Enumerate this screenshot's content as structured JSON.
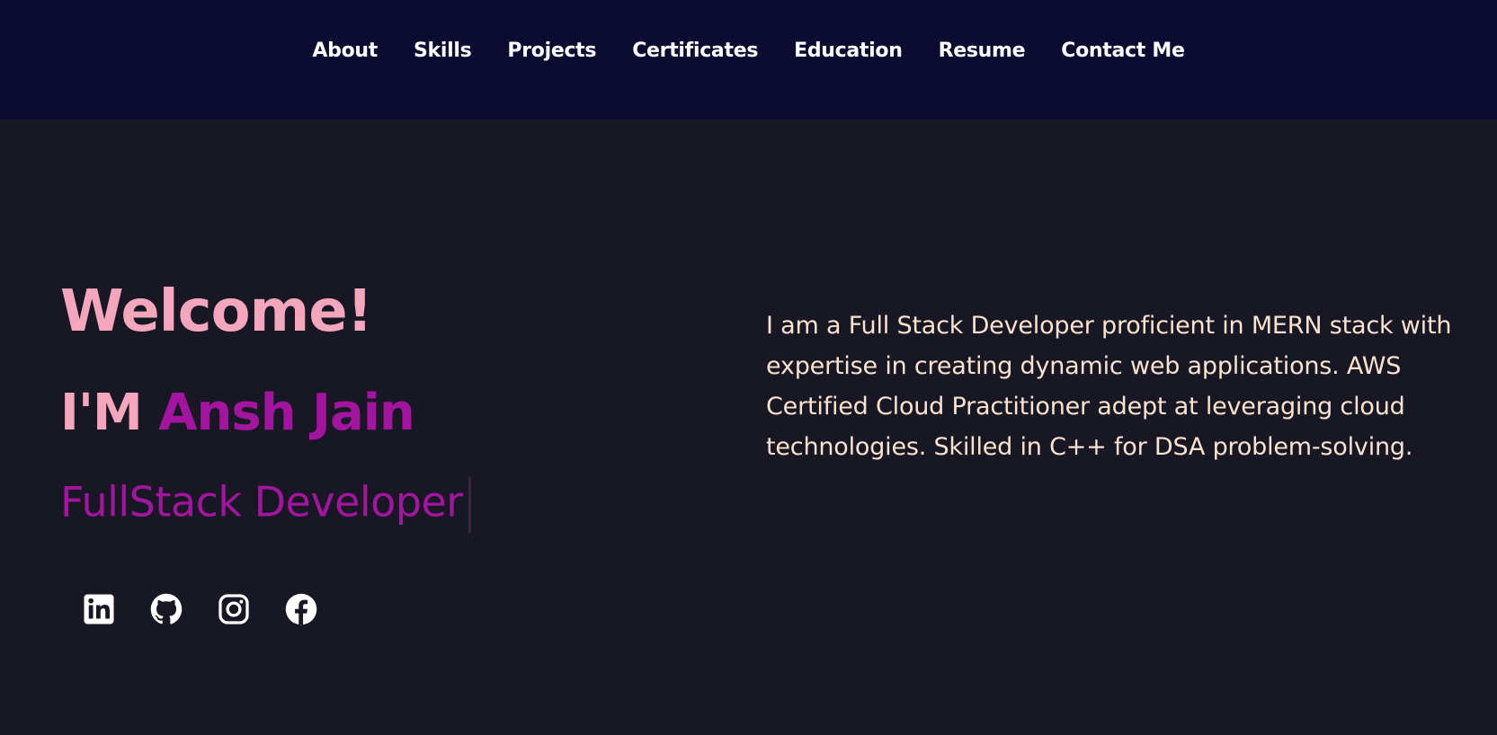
{
  "nav": {
    "items": [
      {
        "label": "About"
      },
      {
        "label": "Skills"
      },
      {
        "label": "Projects"
      },
      {
        "label": "Certificates"
      },
      {
        "label": "Education"
      },
      {
        "label": "Resume"
      },
      {
        "label": "Contact Me"
      }
    ]
  },
  "hero": {
    "welcome": "Welcome!",
    "intro_prefix": "I'M ",
    "name": "Ansh Jain",
    "role": "FullStack Developer",
    "bio": "I am a Full Stack Developer proficient in MERN stack with expertise in creating dynamic web applications. AWS Certified Cloud Practitioner adept at leveraging cloud technologies. Skilled in C++ for DSA problem-solving."
  },
  "socials": [
    {
      "icon": "linkedin-icon"
    },
    {
      "icon": "github-icon"
    },
    {
      "icon": "instagram-icon"
    },
    {
      "icon": "facebook-icon"
    }
  ],
  "colors": {
    "nav_bg": "#0c0c33",
    "page_bg": "#181824",
    "accent_pink": "#f4a6bd",
    "accent_magenta": "#a3159f",
    "bio_text": "#fbe3cf"
  }
}
